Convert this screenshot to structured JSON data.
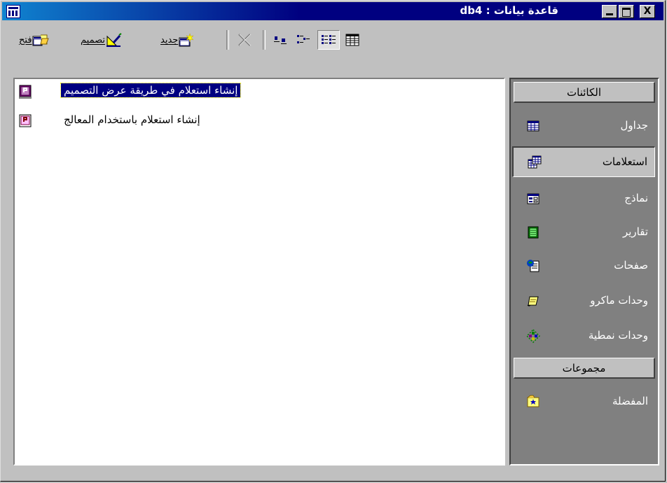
{
  "window": {
    "title": "قاعدة بيانات : db4",
    "min_label": "_",
    "max_label": "",
    "close_label": "X"
  },
  "toolbar": {
    "open_label": "فتح",
    "design_label": "تصميم",
    "new_label": "جديد"
  },
  "list": {
    "items": [
      {
        "label": "إنشاء استعلام في طريقة عرض التصميم",
        "selected": true
      },
      {
        "label": "إنشاء استعلام باستخدام المعالج",
        "selected": false
      }
    ]
  },
  "sidebar": {
    "objects_header": "الكائنات",
    "groups_header": "مجموعات",
    "objects": [
      {
        "label": "جداول",
        "icon": "table-icon"
      },
      {
        "label": "استعلامات",
        "icon": "query-icon",
        "active": true
      },
      {
        "label": "نماذج",
        "icon": "form-icon"
      },
      {
        "label": "تقارير",
        "icon": "report-icon"
      },
      {
        "label": "صفحات",
        "icon": "page-icon"
      },
      {
        "label": "وحدات ماكرو",
        "icon": "macro-icon"
      },
      {
        "label": "وحدات نمطية",
        "icon": "module-icon"
      }
    ],
    "groups": [
      {
        "label": "المفضلة",
        "icon": "favorites-icon"
      }
    ]
  },
  "colors": {
    "titlebar": "#000080",
    "face": "#c0c0c0",
    "pane": "#808080",
    "selection": "#000080"
  }
}
